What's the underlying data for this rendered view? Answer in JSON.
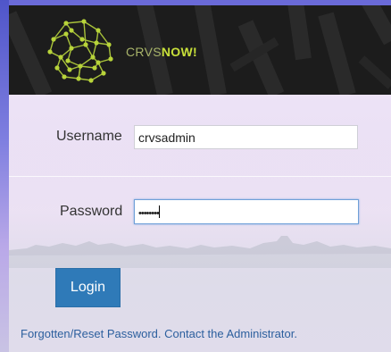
{
  "brand": {
    "part1": "CRVS",
    "part2": "NOW!"
  },
  "colors": {
    "accent": "#c8e03a",
    "button": "#2f7ab8",
    "link": "#2c5f9e",
    "banner": "#1c1c1c"
  },
  "form": {
    "username_label": "Username",
    "username_value": "crvsadmin",
    "password_label": "Password",
    "password_value": "••••••••",
    "login_label": "Login",
    "forgot_text": "Forgotten/Reset Password. Contact the Administrator."
  },
  "icons": {
    "logo": "crvs-network-logo-icon"
  }
}
